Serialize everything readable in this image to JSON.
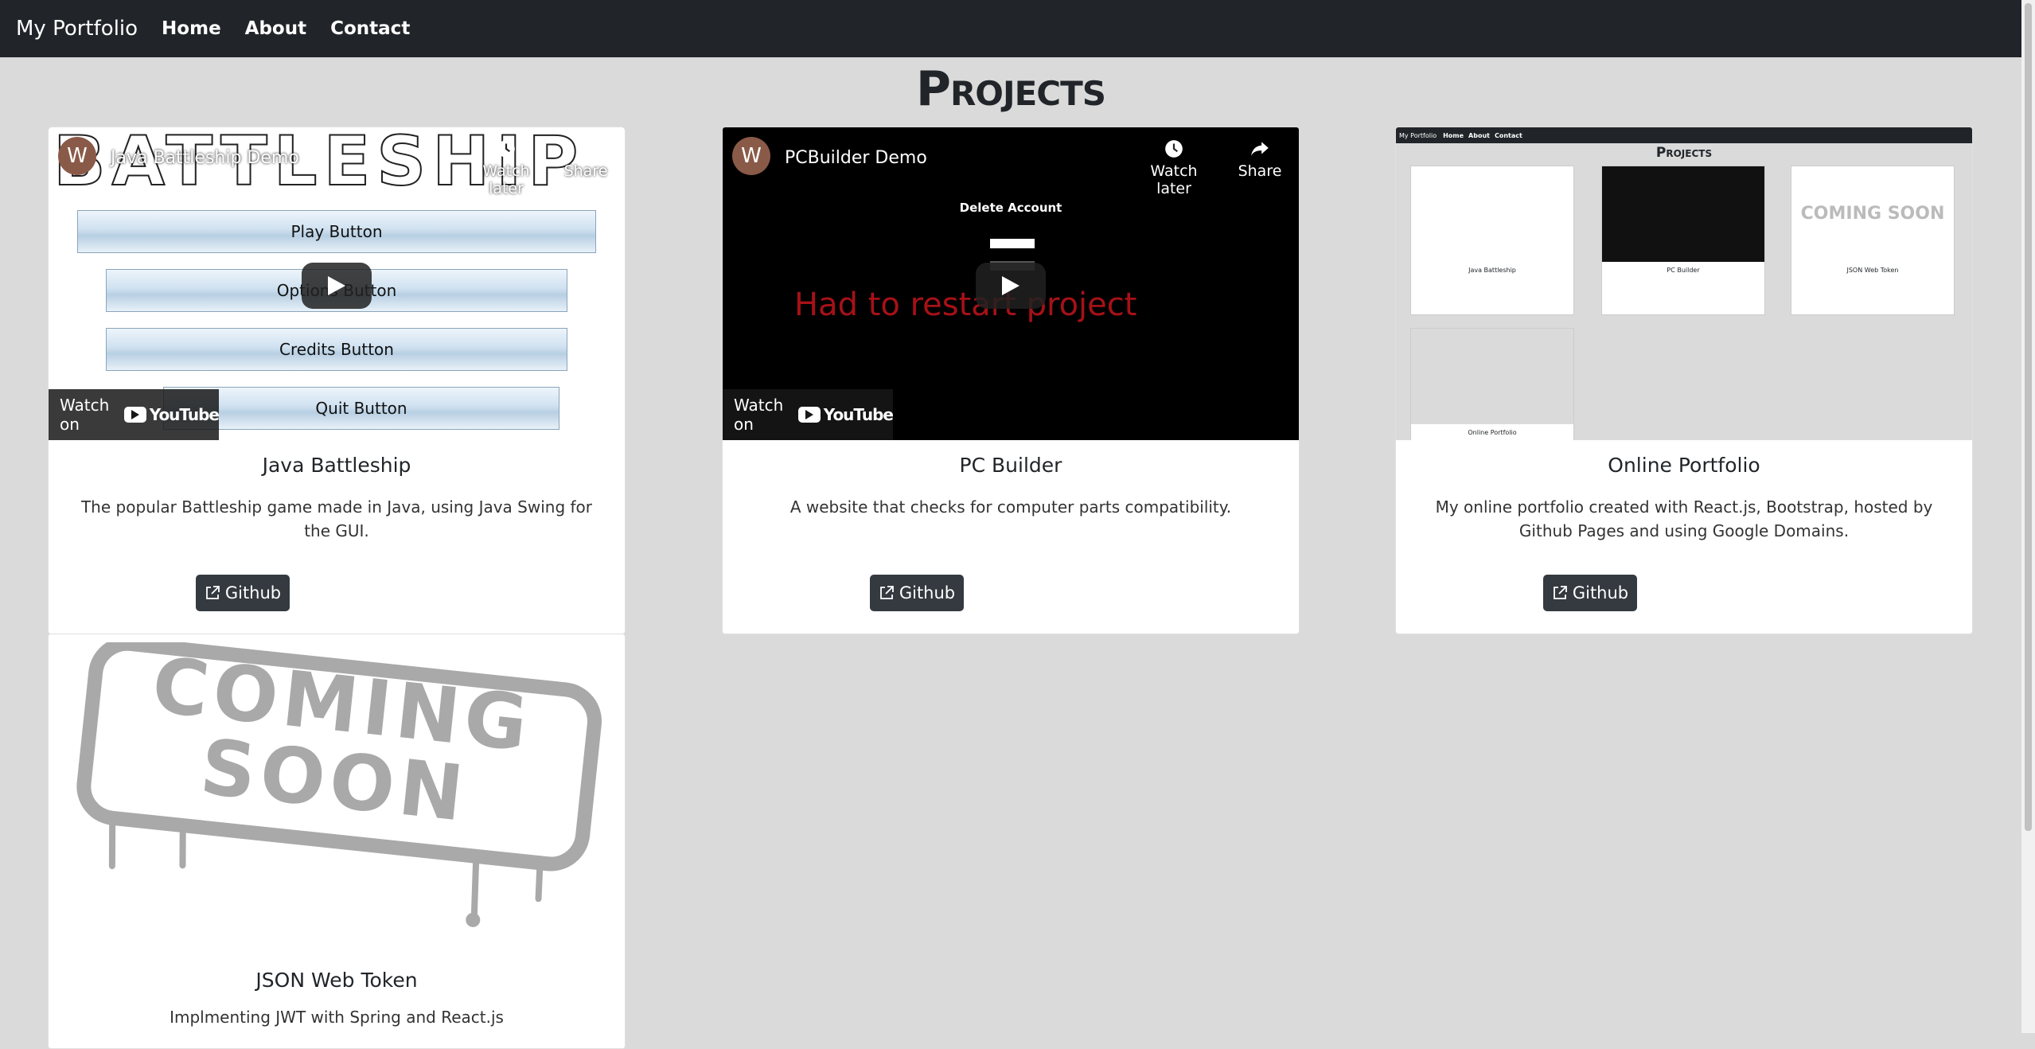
{
  "navbar": {
    "brand": "My Portfolio",
    "links": [
      "Home",
      "About",
      "Contact"
    ]
  },
  "page_title": "Projects",
  "projects": [
    {
      "title": "Java Battleship",
      "description": "The popular Battleship game made in Java, using Java Swing for the GUI.",
      "button": "Github",
      "video": {
        "channel_initial": "W",
        "title": "Java Battleship Demo",
        "watch_later": "Watch later",
        "share": "Share",
        "watch_on": "Watch on",
        "youtube": "YouTube",
        "banner": "BATTLESHIP",
        "menu_buttons": [
          "Play Button",
          "Options Button",
          "Credits Button",
          "Quit Button"
        ]
      }
    },
    {
      "title": "PC Builder",
      "description": "A website that checks for computer parts compatibility.",
      "button": "Github",
      "video": {
        "channel_initial": "W",
        "title": "PCBuilder Demo",
        "watch_later": "Watch later",
        "share": "Share",
        "watch_on": "Watch on",
        "youtube": "YouTube",
        "form_title": "Delete Account",
        "overlay": "Had to restart project"
      }
    },
    {
      "title": "Online Portfolio",
      "description": "My online portfolio created with React.js, Bootstrap, hosted by Github Pages and using Google Domains.",
      "button": "Github",
      "screenshot": {
        "brand": "My Portfolio",
        "links": [
          "Home",
          "About",
          "Contact"
        ],
        "title": "Projects",
        "cards": [
          "Java Battleship",
          "PC Builder",
          "JSON Web Token",
          "Online Portfolio"
        ]
      }
    },
    {
      "title": "JSON Web Token",
      "description": "Implmenting JWT with Spring and React.js",
      "image": "COMING SOON"
    }
  ],
  "colors": {
    "navbar": "#212529",
    "background": "#dadada",
    "button": "#343a40",
    "accent_red": "#c4151c"
  },
  "icons": [
    "external-link-icon",
    "clock-icon",
    "share-icon",
    "play-icon",
    "youtube-logo-icon"
  ]
}
